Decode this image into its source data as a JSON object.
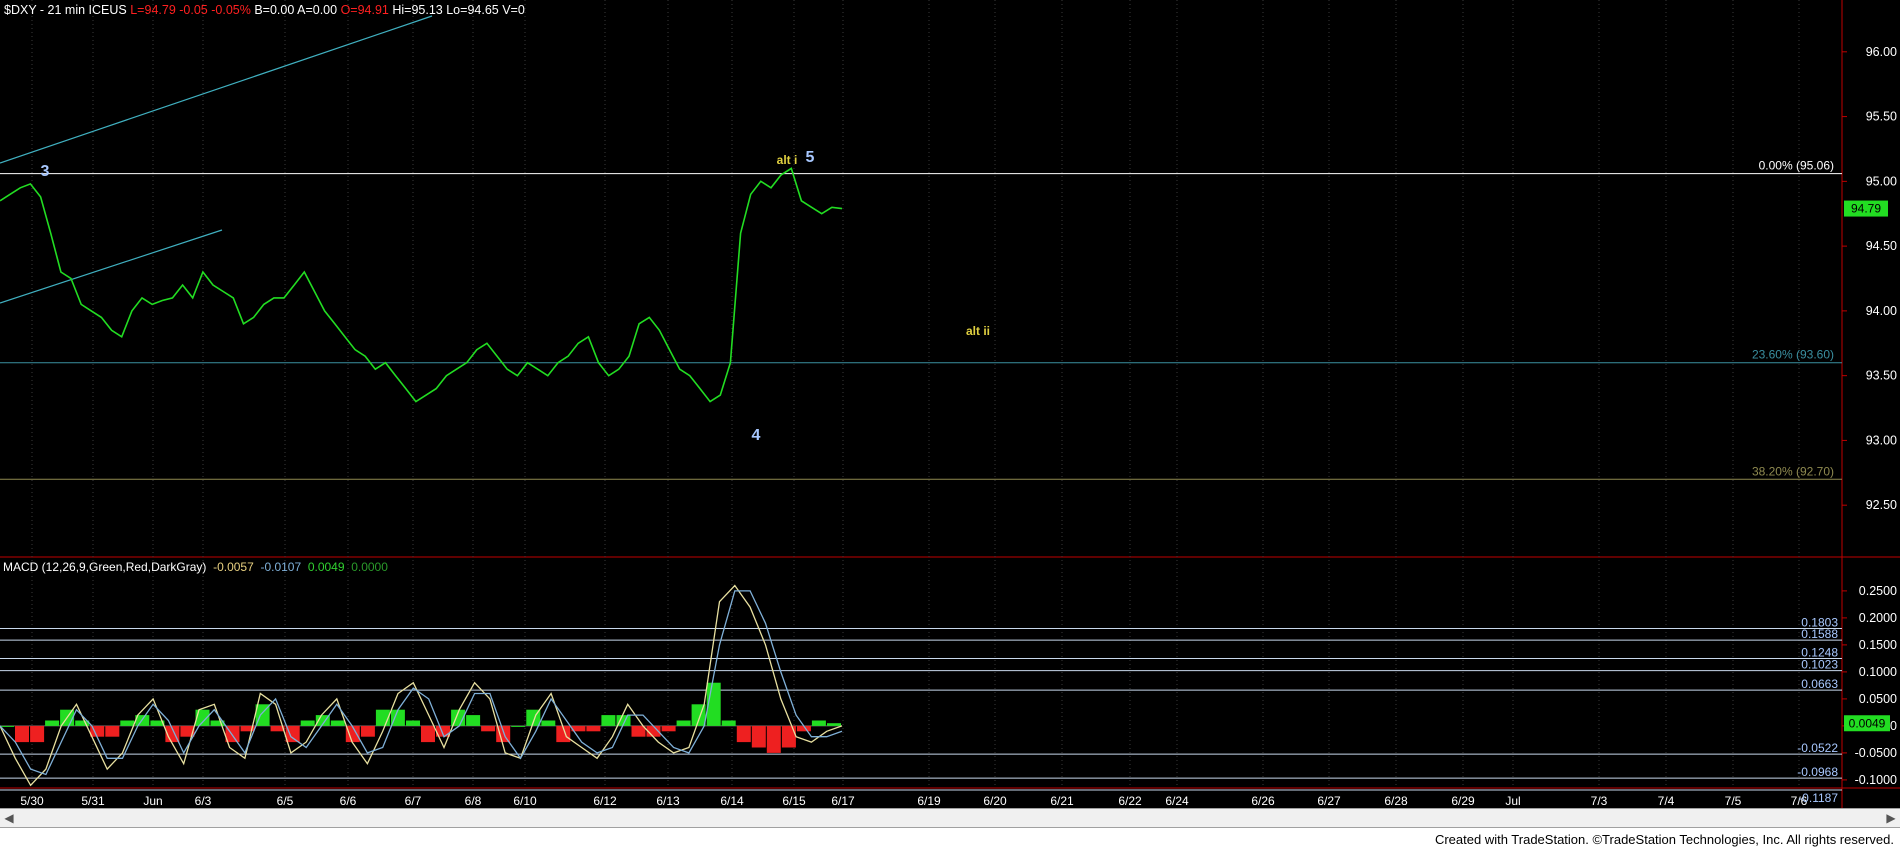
{
  "header": {
    "symbol": "$DXY - 21 min",
    "exchange": "ICEUS",
    "last": "L=94.79",
    "change": "-0.05",
    "change_pct": "-0.05%",
    "bid": "B=0.00",
    "ask": "A=0.00",
    "open": "O=94.91",
    "high": "Hi=95.13",
    "low": "Lo=94.65",
    "volume": "V=0"
  },
  "macd_header": {
    "label": "MACD (12,26,9,Green,Red,DarkGray)",
    "v1": "-0.0057",
    "v2": "-0.0107",
    "v3": "0.0049",
    "v4": "0.0000",
    "colors": {
      "v1": "#e8d080",
      "v2": "#7fb0d8",
      "v3": "#30d030",
      "v4": "#2a9a2a"
    }
  },
  "footer": {
    "text": "Created with TradeStation. ©TradeStation Technologies, Inc. All rights reserved."
  },
  "colors": {
    "price": "#22dd22",
    "fib_top": "#ffffff",
    "fib_236": "#3a8fa0",
    "fib_382": "#8f8a50",
    "trend": "#40b0c0",
    "wave_blue": "#a8c8ff",
    "wave_yellow": "#e0d040",
    "axis_text": "#ffffff",
    "label_price_bg": "#22dd22",
    "label_macd_bg": "#22dd22"
  },
  "chart_data": {
    "type": "line",
    "title": "$DXY - 21 min",
    "x_ticks": [
      "5/30",
      "5/31",
      "Jun",
      "6/3",
      "6/5",
      "6/6",
      "6/7",
      "6/8",
      "6/10",
      "6/12",
      "6/13",
      "6/14",
      "6/15",
      "6/17",
      "6/19",
      "6/20",
      "6/21",
      "6/22",
      "6/24",
      "6/26",
      "6/27",
      "6/28",
      "6/29",
      "Jul",
      "7/3",
      "7/4",
      "7/5",
      "7/6"
    ],
    "price_axis": {
      "ylim": [
        92.1,
        96.4
      ],
      "ticks": [
        "96.00",
        "95.50",
        "95.00",
        "94.50",
        "94.00",
        "93.50",
        "93.00",
        "92.50"
      ],
      "last_label": "94.79"
    },
    "series": [
      {
        "values": [
          94.85,
          94.9,
          94.95,
          94.98,
          94.88,
          94.6,
          94.3,
          94.25,
          94.05,
          94.0,
          93.95,
          93.85,
          93.8,
          94.0,
          94.1,
          94.05,
          94.08,
          94.1,
          94.2,
          94.1,
          94.3,
          94.2,
          94.15,
          94.1,
          93.9,
          93.95,
          94.05,
          94.1,
          94.1,
          94.2,
          94.3,
          94.15,
          94.0,
          93.9,
          93.8,
          93.7,
          93.65,
          93.55,
          93.6,
          93.5,
          93.4,
          93.3,
          93.35,
          93.4,
          93.5,
          93.55,
          93.6,
          93.7,
          93.75,
          93.65,
          93.55,
          93.5,
          93.6,
          93.55,
          93.5,
          93.6,
          93.65,
          93.75,
          93.8,
          93.6,
          93.5,
          93.55,
          93.65,
          93.9,
          93.95,
          93.85,
          93.7,
          93.55,
          93.5,
          93.4,
          93.3,
          93.35,
          93.6,
          94.6,
          94.9,
          95.0,
          94.95,
          95.05,
          95.1,
          94.85,
          94.8,
          94.75,
          94.8,
          94.79
        ]
      }
    ],
    "fib_levels": [
      {
        "label": "0.00% (95.06)",
        "value": 95.06
      },
      {
        "label": "23.60% (93.60)",
        "value": 93.6
      },
      {
        "label": "38.20% (92.70)",
        "value": 92.7
      }
    ],
    "wave_labels": [
      {
        "text": "3",
        "color_key": "wave_blue"
      },
      {
        "text": "4",
        "color_key": "wave_blue"
      },
      {
        "text": "5",
        "color_key": "wave_blue"
      },
      {
        "text": "alt i",
        "color_key": "wave_yellow"
      },
      {
        "text": "alt ii",
        "color_key": "wave_yellow"
      }
    ],
    "macd": {
      "ylim": [
        -0.115,
        0.285
      ],
      "ticks": [
        "0.2500",
        "0.2000",
        "0.1500",
        "0.1000",
        "0.0500",
        "0.0000",
        "-0.0500",
        "-0.1000"
      ],
      "last_label": "0.0049",
      "levels": [
        {
          "label": "0.1803",
          "value": 0.1803
        },
        {
          "label": "0.1588",
          "value": 0.1588
        },
        {
          "label": "0.1248",
          "value": 0.1248
        },
        {
          "label": "0.1023",
          "value": 0.1023
        },
        {
          "label": "0.0663",
          "value": 0.0663
        },
        {
          "label": "-0.0522",
          "value": -0.0522
        },
        {
          "label": "-0.0968",
          "value": -0.0968
        },
        {
          "label": "-0.1187",
          "value": -0.1187
        }
      ],
      "macd_line": [
        0.0,
        -0.06,
        -0.11,
        -0.08,
        0.0,
        0.04,
        -0.02,
        -0.08,
        -0.05,
        0.02,
        0.05,
        -0.02,
        -0.07,
        0.03,
        0.04,
        -0.04,
        -0.06,
        0.06,
        0.04,
        -0.05,
        -0.03,
        0.02,
        0.05,
        -0.03,
        -0.07,
        -0.01,
        0.06,
        0.08,
        0.02,
        -0.04,
        0.03,
        0.08,
        0.05,
        -0.05,
        -0.06,
        0.02,
        0.06,
        -0.02,
        -0.04,
        -0.06,
        -0.02,
        0.04,
        0.0,
        -0.03,
        -0.05,
        -0.04,
        0.04,
        0.23,
        0.26,
        0.22,
        0.15,
        0.05,
        -0.02,
        -0.03,
        -0.01,
        0.0
      ],
      "signal_line": [
        0.0,
        -0.03,
        -0.08,
        -0.09,
        -0.03,
        0.03,
        0.0,
        -0.06,
        -0.06,
        0.0,
        0.04,
        0.01,
        -0.05,
        0.0,
        0.03,
        -0.01,
        -0.05,
        0.02,
        0.05,
        -0.02,
        -0.04,
        0.0,
        0.04,
        0.0,
        -0.05,
        -0.04,
        0.03,
        0.07,
        0.05,
        -0.02,
        0.0,
        0.06,
        0.06,
        -0.02,
        -0.06,
        -0.01,
        0.05,
        0.01,
        -0.03,
        -0.05,
        -0.04,
        0.02,
        0.02,
        -0.01,
        -0.04,
        -0.05,
        0.0,
        0.15,
        0.25,
        0.25,
        0.19,
        0.1,
        0.02,
        -0.02,
        -0.02,
        -0.01
      ],
      "histogram": [
        0.0,
        -0.03,
        -0.03,
        0.01,
        0.03,
        0.01,
        -0.02,
        -0.02,
        0.01,
        0.02,
        0.01,
        -0.03,
        -0.02,
        0.03,
        0.01,
        -0.03,
        -0.01,
        0.04,
        -0.01,
        -0.03,
        0.01,
        0.02,
        0.01,
        -0.03,
        -0.02,
        0.03,
        0.03,
        0.01,
        -0.03,
        -0.02,
        0.03,
        0.02,
        -0.01,
        -0.03,
        0.0,
        0.03,
        0.01,
        -0.03,
        -0.01,
        -0.01,
        0.02,
        0.02,
        -0.02,
        -0.02,
        -0.01,
        0.01,
        0.04,
        0.08,
        0.01,
        -0.03,
        -0.04,
        -0.05,
        -0.04,
        -0.01,
        0.01,
        0.005
      ]
    }
  }
}
